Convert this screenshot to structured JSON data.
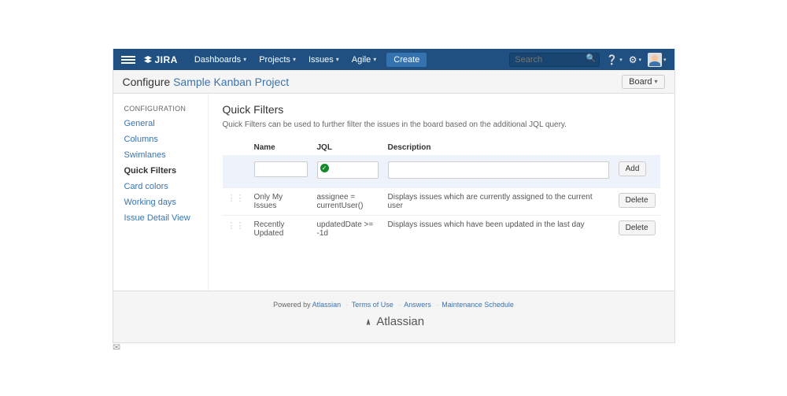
{
  "nav": {
    "brand": "JIRA",
    "items": [
      "Dashboards",
      "Projects",
      "Issues",
      "Agile"
    ],
    "create": "Create",
    "search_placeholder": "Search"
  },
  "pagehead": {
    "prefix": "Configure",
    "project": "Sample Kanban Project",
    "board_btn": "Board"
  },
  "sidebar": {
    "heading": "CONFIGURATION",
    "items": [
      {
        "label": "General",
        "active": false
      },
      {
        "label": "Columns",
        "active": false
      },
      {
        "label": "Swimlanes",
        "active": false
      },
      {
        "label": "Quick Filters",
        "active": true
      },
      {
        "label": "Card colors",
        "active": false
      },
      {
        "label": "Working days",
        "active": false
      },
      {
        "label": "Issue Detail View",
        "active": false
      }
    ]
  },
  "main": {
    "title": "Quick Filters",
    "description": "Quick Filters can be used to further filter the issues in the board based on the additional JQL query.",
    "columns": [
      "Name",
      "JQL",
      "Description"
    ],
    "add_btn": "Add",
    "delete_btn": "Delete",
    "filters": [
      {
        "name": "Only My Issues",
        "jql": "assignee = currentUser()",
        "desc": "Displays issues which are currently assigned to the current user"
      },
      {
        "name": "Recently Updated",
        "jql": "updatedDate >= -1d",
        "desc": "Displays issues which have been updated in the last day"
      }
    ]
  },
  "footer": {
    "powered": "Powered by ",
    "atlassian_link": "Atlassian",
    "links": [
      "Terms of Use",
      "Answers",
      "Maintenance Schedule"
    ],
    "brand": "Atlassian"
  }
}
